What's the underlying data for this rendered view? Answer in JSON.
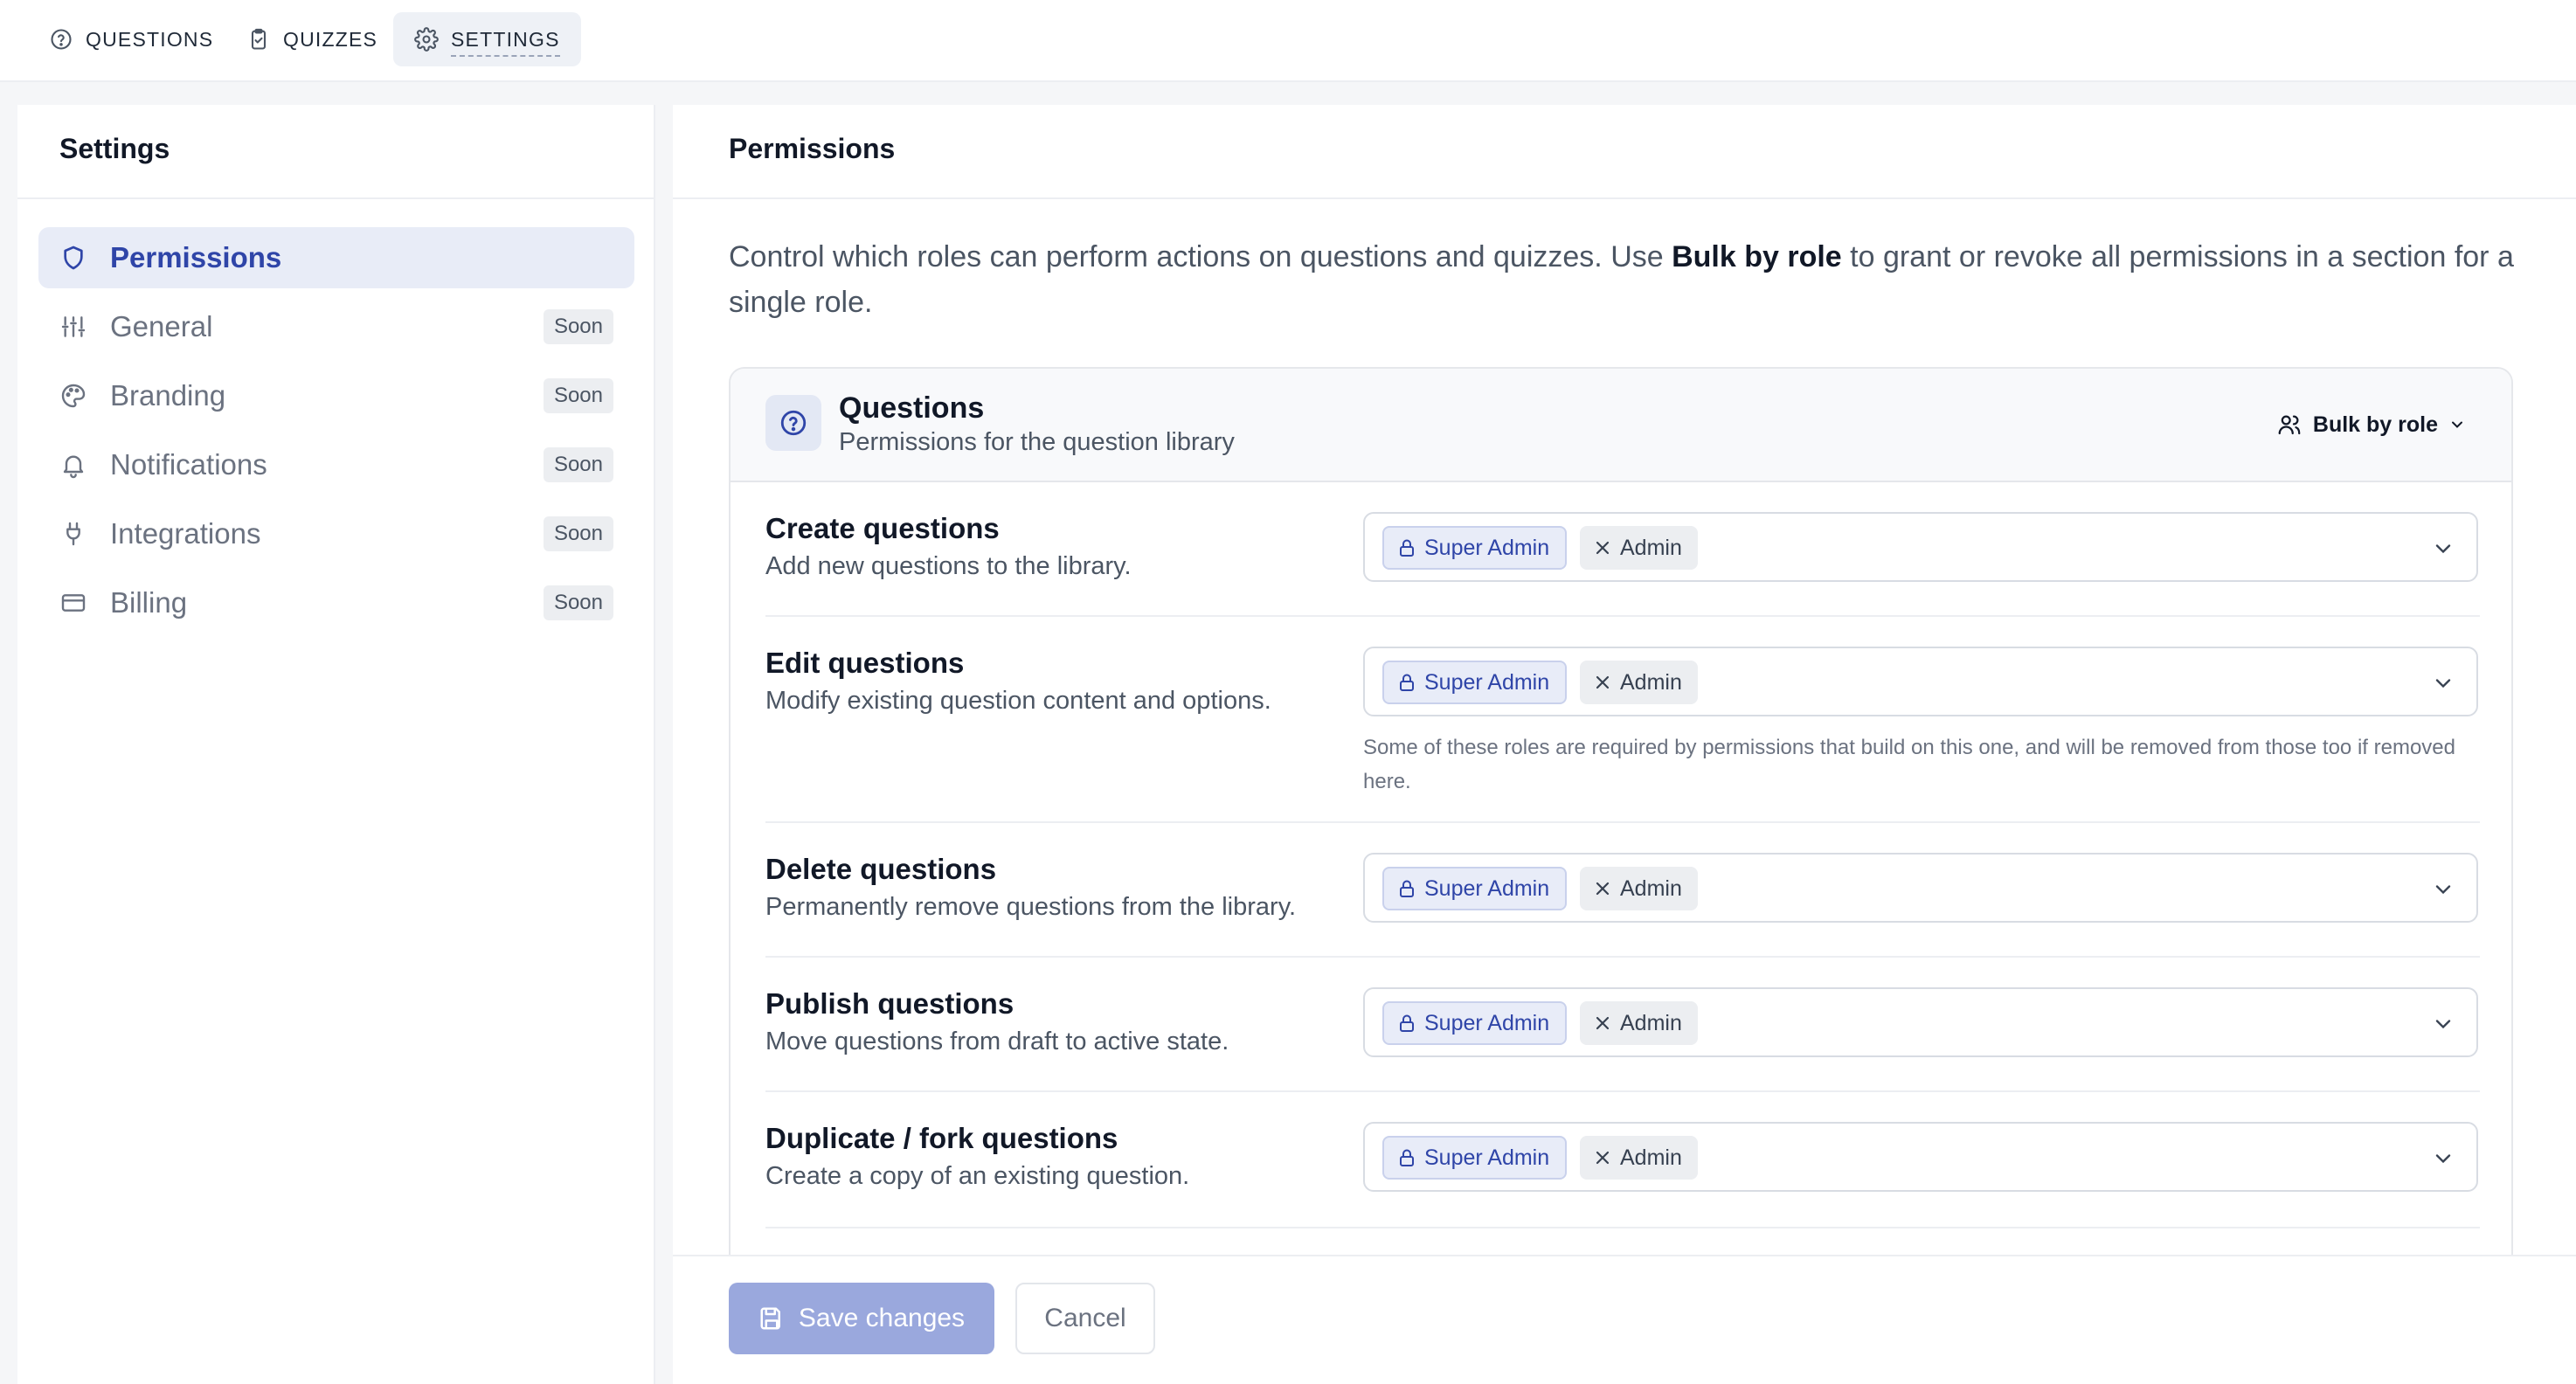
{
  "tabs": [
    {
      "label": "QUESTIONS",
      "icon": "help-circle-icon"
    },
    {
      "label": "QUIZZES",
      "icon": "clipboard-icon"
    },
    {
      "label": "SETTINGS",
      "icon": "gear-icon",
      "active": true
    }
  ],
  "sidebar": {
    "title": "Settings",
    "items": [
      {
        "label": "Permissions",
        "icon": "shield-icon",
        "active": true
      },
      {
        "label": "General",
        "icon": "sliders-icon",
        "badge": "Soon"
      },
      {
        "label": "Branding",
        "icon": "palette-icon",
        "badge": "Soon"
      },
      {
        "label": "Notifications",
        "icon": "bell-icon",
        "badge": "Soon"
      },
      {
        "label": "Integrations",
        "icon": "plug-icon",
        "badge": "Soon"
      },
      {
        "label": "Billing",
        "icon": "credit-card-icon",
        "badge": "Soon"
      }
    ]
  },
  "main": {
    "title": "Permissions",
    "intro_before": "Control which roles can perform actions on questions and quizzes. Use ",
    "intro_bold": "Bulk by role",
    "intro_after": " to grant or revoke all permissions in a section for a single role."
  },
  "section": {
    "title": "Questions",
    "subtitle": "Permissions for the question library",
    "bulk_label": "Bulk by role",
    "permissions": [
      {
        "title": "Create questions",
        "description": "Add new questions to the library.",
        "locked_role": "Super Admin",
        "role": "Admin"
      },
      {
        "title": "Edit questions",
        "description": "Modify existing question content and options.",
        "locked_role": "Super Admin",
        "role": "Admin",
        "note": "Some of these roles are required by permissions that build on this one, and will be removed from those too if removed here."
      },
      {
        "title": "Delete questions",
        "description": "Permanently remove questions from the library.",
        "locked_role": "Super Admin",
        "role": "Admin"
      },
      {
        "title": "Publish questions",
        "description": "Move questions from draft to active state.",
        "locked_role": "Super Admin",
        "role": "Admin"
      },
      {
        "title": "Duplicate / fork questions",
        "description": "Create a copy of an existing question.",
        "locked_role": "Super Admin",
        "role": "Admin"
      }
    ]
  },
  "footer": {
    "save_label": "Save changes",
    "cancel_label": "Cancel"
  },
  "colors": {
    "accent": "#2f45a8",
    "active_nav_bg": "#e8ecf7",
    "save_button_disabled": "#9aa8dd"
  }
}
